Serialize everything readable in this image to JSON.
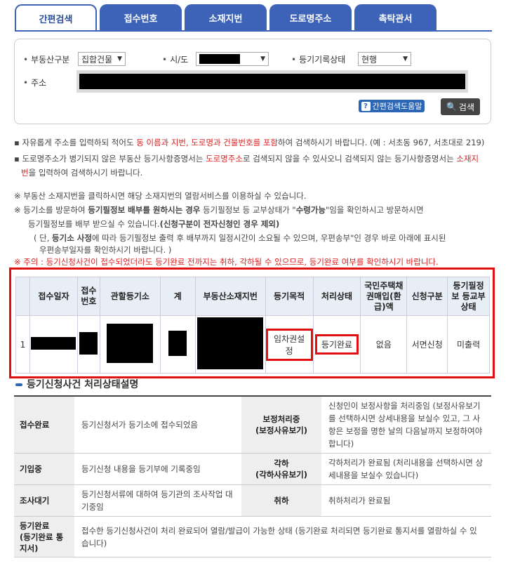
{
  "tabs": [
    "간편검색",
    "접수번호",
    "소재지번",
    "도로명주소",
    "촉탁관서"
  ],
  "search": {
    "property_type_label": "부동산구분",
    "property_type_value": "집합건물",
    "sido_label": "시/도",
    "registry_status_label": "등기기록상태",
    "registry_status_value": "현행",
    "address_label": "주소",
    "help_label": "간편검색도움말",
    "search_button": "검색"
  },
  "notes": {
    "n1_a": "자유롭게 주소를 입력하되 적어도 ",
    "n1_red": "동 이름과 지번, 도로명과 건물번호를 포함",
    "n1_b": "하여 검색하시기 바랍니다. (예 : 서초동 967, 서초대로 219)",
    "n2_a": "도로명주소가 병기되지 않은 부동산 등기사항증명서는 ",
    "n2_red": "도로명주소",
    "n2_b": "로 검색되지 않을 수 있사오니 검색되지 않는 등기사항증명서는 ",
    "n2_red2": "소재지",
    "n2_red3": "번",
    "n2_c": "을 입력하여 검색하시기 바랍니다.",
    "n3": "※ 부동산 소재지번을 클릭하시면 해당 소재지번의 열람서비스를 이용하실 수 있습니다.",
    "n4_a": "※ 등기소를 방문하여 ",
    "n4_bold": "등기필정보 배부를 원하시는 경우",
    "n4_b": " 등기필정보 등 교부상태가 \"",
    "n4_bold2": "수령가능",
    "n4_c": "\"임을 확인하시고 방문하시면",
    "n5_a": "등기필정보를 배부 받으실 수 있습니다.",
    "n5_bold": "(신청구분이 전자신청인 경우 제외)",
    "n6_a": "( 단, ",
    "n6_bold": "등기소 사정",
    "n6_b": "에 따라 등기필정보 출력 후 배부까지 일정시간이 소요될 수 있으며, 우편송부\"인 경우 바로 아래에 표시된",
    "n7": "우편송부일자를 확인하시기 바랍니다. )",
    "n8": "※ 주의 : 등기신청사건이 접수되었더라도 등기완료 전까지는 취하, 각하될 수 있으므로, 등기완료 여부를 확인하시기 바랍니다."
  },
  "results": {
    "headers": [
      "접수일자",
      "접수번호",
      "관할등기소",
      "계",
      "부동산소재지번",
      "등기목적",
      "처리상태",
      "국민주택채권매입(환급)액",
      "신청구분",
      "등기필정보 등교부상태"
    ],
    "row": {
      "num": "1",
      "purpose": "임차권설정",
      "status": "등기완료",
      "bond": "없음",
      "apply_type": "서면신청",
      "delivery": "미출력"
    }
  },
  "section_title": "등기신청사건 처리상태설명",
  "desc": {
    "r1_h1": "접수완료",
    "r1_d1": "등기신청서가 등기소에 접수되었음",
    "r1_h2": "보정처리중\n(보정사유보기)",
    "r1_d2": "신청인이 보정사항을 처리중임 (보정사유보기를 선택하시면 상세내용을 보실수 있고, 그 사항은 보정을 명한 날의 다음날까지 보정하여야 합니다)",
    "r2_h1": "기입중",
    "r2_d1": "등기신청 내용을 등기부에 기록중임",
    "r2_h2": "각하\n(각하사유보기)",
    "r2_d2": "각하처리가 완료됨 (처리내용을 선택하시면 상세내용을 보실수 있습니다)",
    "r3_h1": "조사대기",
    "r3_d1": "등기신청서류에 대하여 등기관의 조사작업 대기중임",
    "r3_h2": "취하",
    "r3_d2": "취하처리가 완료됨",
    "r4_h1": "등기완료\n(등기완료 통지서)",
    "r4_d1": "접수한 등기신청사건이 처리 완료되어 열람/발급이 가능한 상태 (등기완료 처리되면 등기완료 통지서를 열람하실 수 있습니다)"
  }
}
